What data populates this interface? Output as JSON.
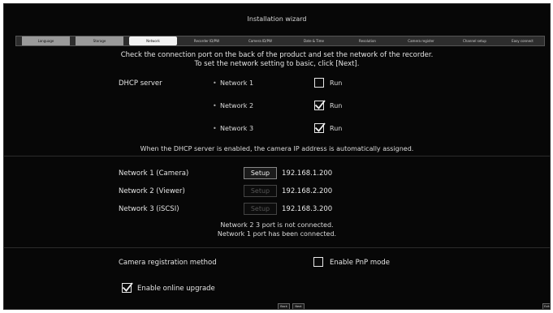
{
  "window": {
    "title": "Installation wizard"
  },
  "tabs": [
    {
      "label": "Language",
      "state": "done"
    },
    {
      "label": "Storage",
      "state": "done"
    },
    {
      "label": "Network",
      "state": "active"
    },
    {
      "label": "Recorder ID/PW",
      "state": "pending"
    },
    {
      "label": "Camera ID/PW",
      "state": "pending"
    },
    {
      "label": "Date & Time",
      "state": "pending"
    },
    {
      "label": "Resolution",
      "state": "pending"
    },
    {
      "label": "Camera register",
      "state": "pending"
    },
    {
      "label": "Channel setup",
      "state": "pending"
    },
    {
      "label": "Easy connect",
      "state": "pending"
    }
  ],
  "intro": {
    "line1": "Check the connection port on the back of the product and set the network of the recorder.",
    "line2": "To set the network setting to basic, click [Next]."
  },
  "dhcp": {
    "label": "DHCP server",
    "bullet": "•",
    "run_label": "Run",
    "rows": [
      {
        "network": "Network 1",
        "run": false
      },
      {
        "network": "Network 2",
        "run": true
      },
      {
        "network": "Network 3",
        "run": true
      }
    ],
    "note": "When the DHCP server is enabled, the camera IP address is automatically assigned."
  },
  "networks": {
    "setup_label": "Setup",
    "rows": [
      {
        "name": "Network 1 (Camera)",
        "ip": "192.168.1.200",
        "setup_enabled": true
      },
      {
        "name": "Network 2 (Viewer)",
        "ip": "192.168.2.200",
        "setup_enabled": false
      },
      {
        "name": "Network 3 (iSCSI)",
        "ip": "192.168.3.200",
        "setup_enabled": false
      }
    ],
    "status_line1": "Network 2 3  port is not connected.",
    "status_line2": "Network 1  port has been connected."
  },
  "camera_registration": {
    "label": "Camera registration method",
    "pnp_label": "Enable PnP mode",
    "pnp_checked": false
  },
  "online_upgrade": {
    "label": "Enable online upgrade",
    "checked": true
  },
  "footer": {
    "back": "Back",
    "next": "Next",
    "exit": "Exit"
  }
}
